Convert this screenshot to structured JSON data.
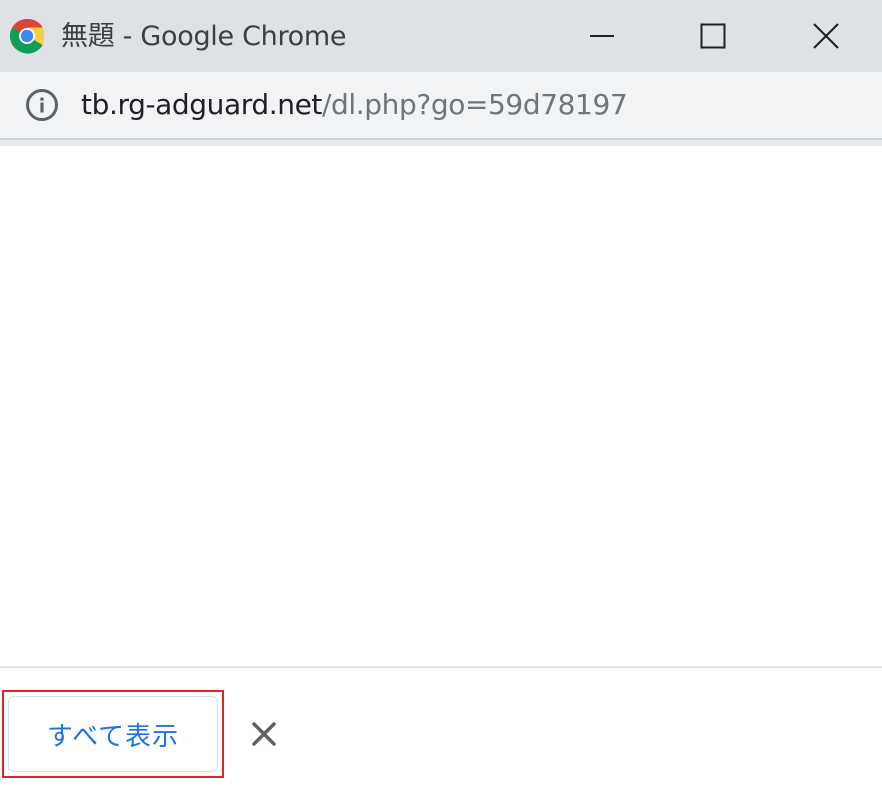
{
  "window": {
    "title": "無題 - Google Chrome",
    "app_icon": "chrome-logo-icon",
    "controls": {
      "minimize_icon": "minimize-icon",
      "maximize_icon": "maximize-icon",
      "close_icon": "close-icon"
    }
  },
  "address_bar": {
    "security_icon": "info-icon",
    "url_host": "tb.rg-adguard.net",
    "url_path": "/dl.php?go=59d78197"
  },
  "download_shelf": {
    "show_all_label": "すべて表示",
    "close_icon": "close-icon",
    "accent_color": "#1a73e8",
    "highlight_color": "#e0242a"
  }
}
